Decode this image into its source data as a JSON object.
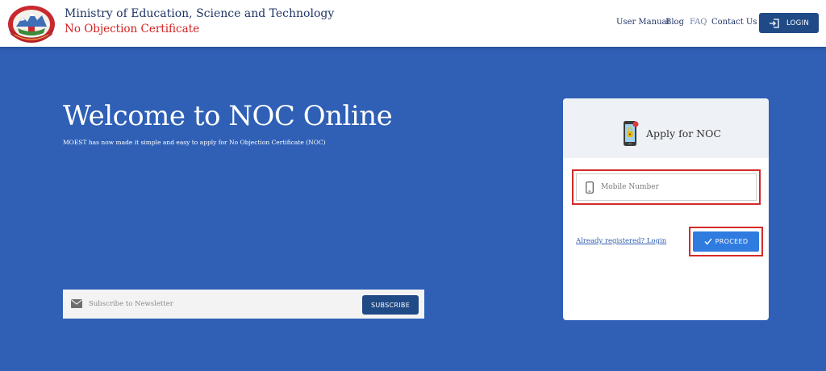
{
  "header": {
    "title": "Ministry of Education, Science and Technology",
    "subtitle": "No Objection Certificate",
    "nav": [
      "User Manual",
      "Blog",
      "FAQ",
      "Contact Us"
    ],
    "login_label": "LOGIN"
  },
  "hero": {
    "title": "Welcome to NOC Online",
    "subtitle": "MOEST has now made it simple and easy to apply for No Objection Certificate (NOC)"
  },
  "newsletter": {
    "placeholder": "Subscribe to Newsletter",
    "button_label": "SUBSCRIBE"
  },
  "card": {
    "title": "Apply for NOC",
    "mobile_placeholder": "Mobile Number",
    "already_registered_label": "Already registered? Login",
    "proceed_label": "PROCEED"
  },
  "colors": {
    "background": "#2f60b6",
    "primary_dark": "#204a86",
    "primary_button": "#2f7be0",
    "accent_red": "#d42020",
    "highlight_border": "#d42a2a"
  },
  "icons": [
    "national-emblem-logo",
    "login-icon",
    "mail-icon",
    "phone-lock-icon",
    "mobile-phone-icon",
    "checkmark-icon"
  ]
}
